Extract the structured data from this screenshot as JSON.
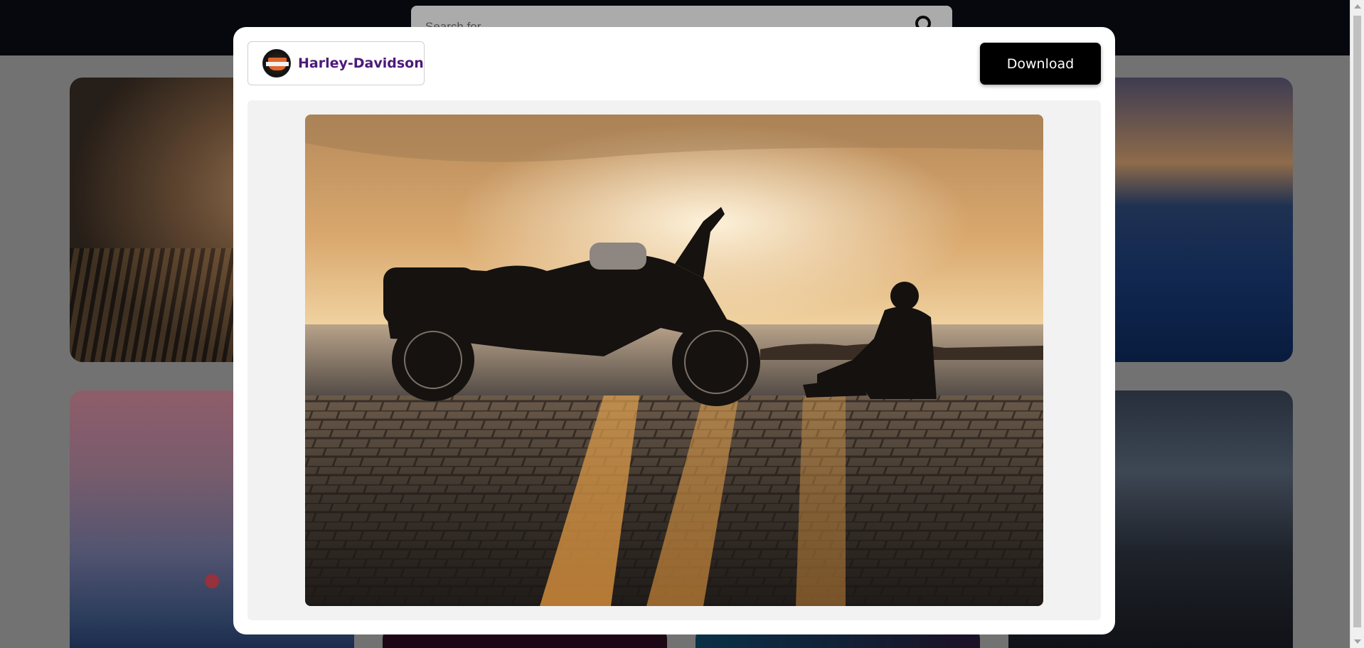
{
  "search": {
    "placeholder": "Search for"
  },
  "modal": {
    "brand": {
      "name": "Harley-Davidson",
      "logo_icon": "harley-davidson-logo-icon"
    },
    "download_label": "Download",
    "photo": {
      "alt": "motorcycle-and-man-at-sunset-photo"
    }
  },
  "colors": {
    "topbar": "#0a0d16",
    "brand_text": "#4b1a7a",
    "download_bg": "#000000"
  }
}
